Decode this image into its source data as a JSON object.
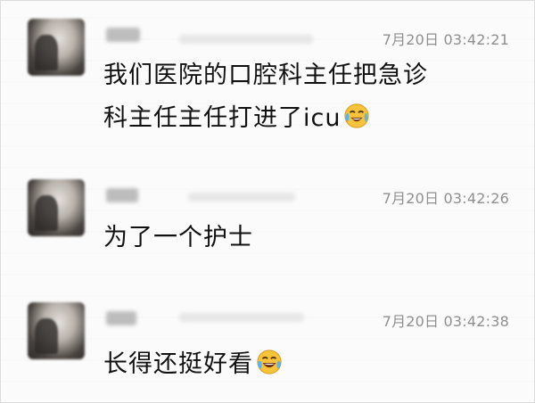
{
  "messages": [
    {
      "sender": "昵称",
      "time": "7月20日 03:42:21",
      "lines": [
        "我们医院的口腔科主任把急诊",
        "科主任主任打进了icu"
      ],
      "emoji": "laughing-crying-emoji"
    },
    {
      "sender": "昵称",
      "time": "7月20日 03:42:26",
      "lines": [
        "为了一个护士"
      ],
      "emoji": ""
    },
    {
      "sender": "昵称",
      "time": "7月20日 03:42:38",
      "lines": [
        "长得还挺好看"
      ],
      "emoji": "tears-of-joy-emoji"
    }
  ],
  "colors": {
    "timestamp": "#8f8f8f",
    "text": "#111111",
    "background": "#fbfbfb",
    "emoji_face": "#f6c33b"
  }
}
